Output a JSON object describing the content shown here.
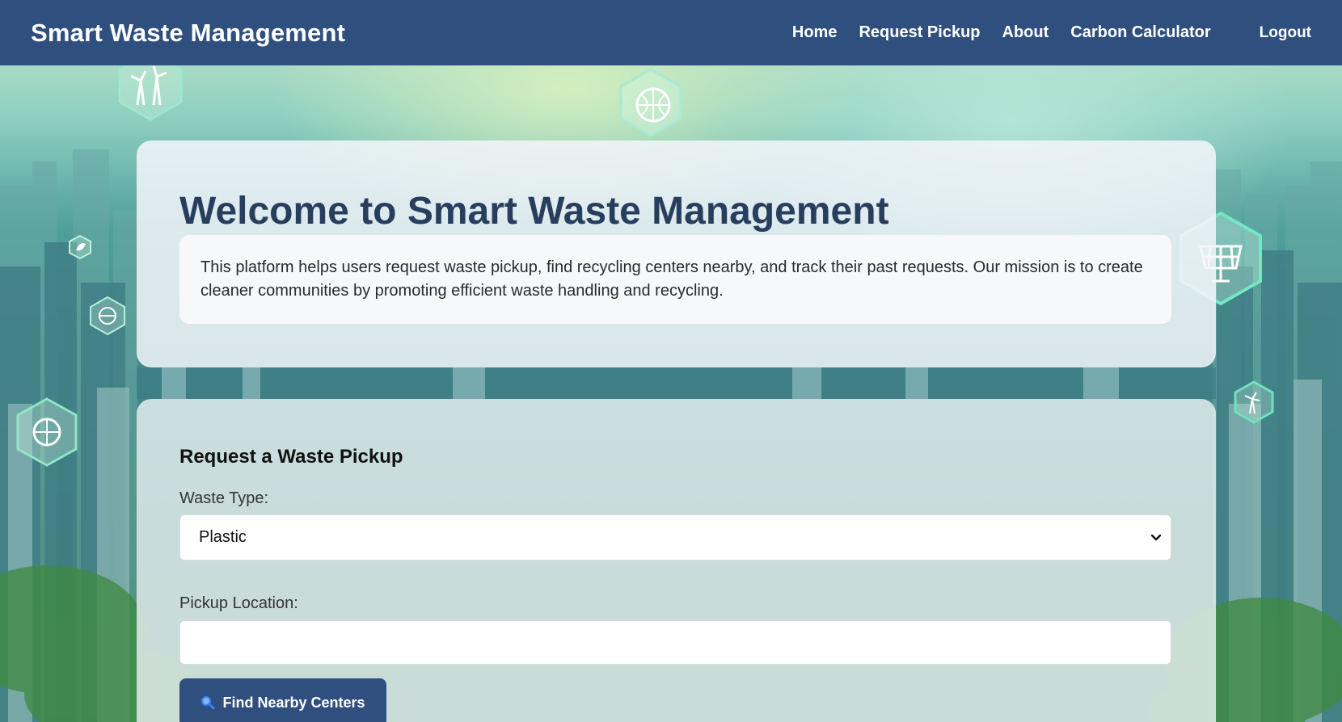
{
  "navbar": {
    "brand": "Smart Waste Management",
    "links": [
      {
        "label": "Home"
      },
      {
        "label": "Request Pickup"
      },
      {
        "label": "About"
      },
      {
        "label": "Carbon Calculator"
      }
    ],
    "logout_label": "Logout",
    "background": "#2f4f7e"
  },
  "intro": {
    "title": "Welcome to Smart Waste Management",
    "description": "This platform helps users request waste pickup, find recycling centers nearby, and track their past requests. Our mission is to create cleaner communities by promoting efficient waste handling and recycling."
  },
  "form": {
    "heading": "Request a Waste Pickup",
    "waste_type_label": "Waste Type:",
    "waste_type_value": "Plastic",
    "pickup_location_label": "Pickup Location:",
    "pickup_location_value": "",
    "find_button_label": "Find Nearby Centers",
    "find_button_icon": "magnifier-icon"
  },
  "colors": {
    "primary": "#2f4f7e",
    "title": "#283e5e"
  }
}
